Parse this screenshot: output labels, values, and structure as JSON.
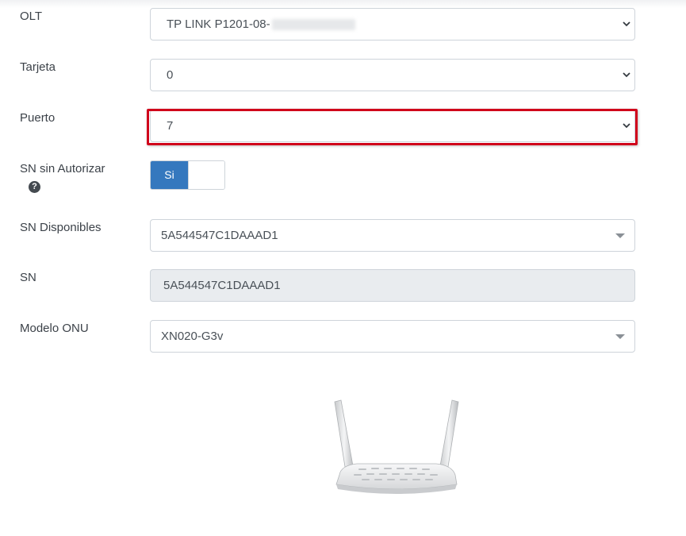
{
  "form": {
    "olt": {
      "label": "OLT",
      "value": "TP LINK P1201-08-"
    },
    "tarjeta": {
      "label": "Tarjeta",
      "value": "0"
    },
    "puerto": {
      "label": "Puerto",
      "value": "7"
    },
    "sn_sin_autorizar": {
      "label": "SN sin Autorizar",
      "toggle_label": "Si",
      "toggle_state": "on",
      "help_glyph": "?"
    },
    "sn_disponibles": {
      "label": "SN Disponibles",
      "value": "5A544547C1DAAAD1"
    },
    "sn": {
      "label": "SN",
      "value": "5A544547C1DAAAD1"
    },
    "modelo_onu": {
      "label": "Modelo ONU",
      "value": "XN020-G3v"
    }
  },
  "icons": {
    "select_arrow": "chevron-down-icon",
    "dropdown_caret": "caret-down-icon",
    "help": "question-circle-icon",
    "device": "router-image"
  },
  "colors": {
    "highlight": "#d0021b",
    "toggle_on": "#3578be"
  }
}
